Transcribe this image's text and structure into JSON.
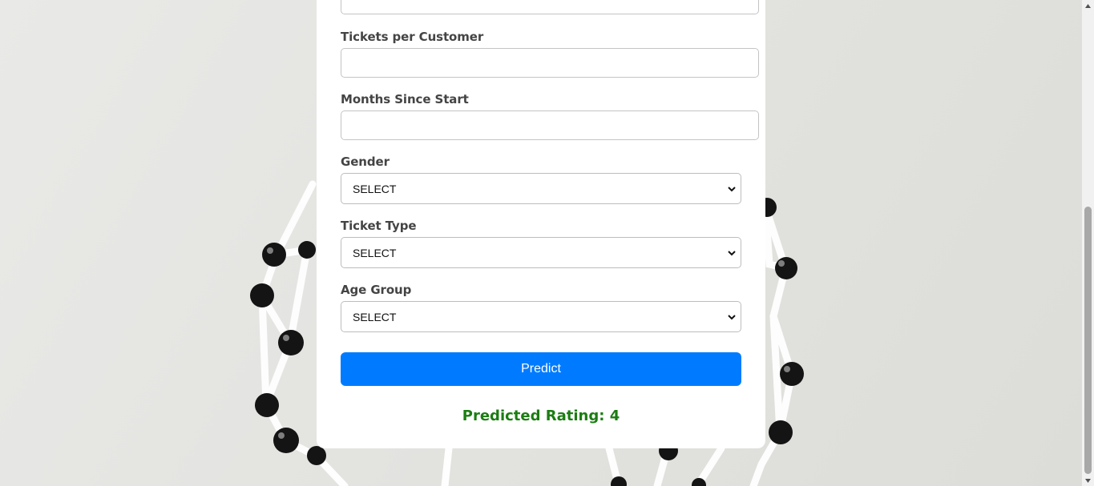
{
  "form": {
    "fields": [
      {
        "label": "Tickets per Customer",
        "value": ""
      },
      {
        "label": "Months Since Start",
        "value": ""
      }
    ],
    "selects": [
      {
        "label": "Gender",
        "value": "SELECT"
      },
      {
        "label": "Ticket Type",
        "value": "SELECT"
      },
      {
        "label": "Age Group",
        "value": "SELECT"
      }
    ],
    "predict_label": "Predict",
    "result_text": "Predicted Rating: 4"
  },
  "colors": {
    "accent": "#007bff",
    "result": "#1b7d12",
    "card": "#ffffff"
  },
  "icons": {
    "select_arrow": "chevron-down-icon",
    "scroll_up": "scroll-up-icon",
    "scroll_down": "scroll-down-icon"
  }
}
